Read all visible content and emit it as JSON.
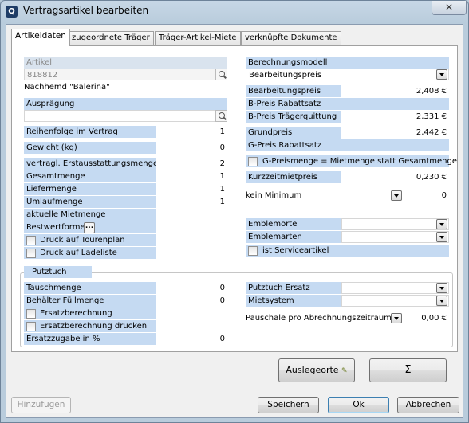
{
  "window": {
    "title": "Vertragsartikel bearbeiten",
    "app_icon_glyph": "Q",
    "close_glyph": "✕"
  },
  "tabs": [
    "Artikeldaten",
    "zugeordnete Träger",
    "Träger-Artikel-Miete",
    "verknüpfte Dokumente"
  ],
  "left": {
    "artikel_label": "Artikel",
    "artikel_value": "818812",
    "artikel_name": "Nachhemd \"Balerina\"",
    "auspraegung_label": "Ausprägung",
    "auspraegung_value": "",
    "reihenfolge_label": "Reihenfolge im Vertrag",
    "reihenfolge_value": "1",
    "gewicht_label": "Gewicht (kg)",
    "gewicht_value": "0",
    "erstausstattung_label": "vertragl. Erstausstattungsmenge",
    "erstausstattung_value": "2",
    "gesamtmenge_label": "Gesamtmenge",
    "gesamtmenge_value": "1",
    "liefermenge_label": "Liefermenge",
    "liefermenge_value": "1",
    "umlaufmenge_label": "Umlaufmenge",
    "umlaufmenge_value": "1",
    "mietmenge_label": "aktuelle Mietmenge",
    "restwertformel_label": "Restwertformel",
    "restwertformel_button": "...",
    "tourenplan_label": "Druck auf Tourenplan",
    "ladeliste_label": "Druck auf Ladeliste"
  },
  "right": {
    "berechnungsmodell_label": "Berechnungsmodell",
    "berechnungsmodell_value": "Bearbeitungspreis",
    "bearbeitungspreis_label": "Bearbeitungspreis",
    "bearbeitungspreis_value": "2,408 €",
    "bpreis_rabatt_label": "B-Preis Rabattsatz",
    "bpreis_rabatt_value": "",
    "bpreis_traeger_label": "B-Preis Trägerquittung",
    "bpreis_traeger_value": "2,331 €",
    "grundpreis_label": "Grundpreis",
    "grundpreis_value": "2,442 €",
    "gpreis_rabatt_label": "G-Preis Rabattsatz",
    "gpreis_rabatt_value": "",
    "gpreismenge_label": "G-Preismenge = Mietmenge statt Gesamtmenge",
    "kurzzeit_label": "Kurzzeitmietpreis",
    "kurzzeit_value": "0,230 €",
    "minimum_label": "kein Minimum",
    "minimum_value": "0",
    "emblemorte_label": "Emblemorte",
    "emblemarten_label": "Emblemarten",
    "serviceartikel_label": "ist Serviceartikel"
  },
  "putztuch": {
    "group_label": "Putztuch",
    "tauschmenge_label": "Tauschmenge",
    "tauschmenge_value": "0",
    "behaelter_label": "Behälter Füllmenge",
    "behaelter_value": "0",
    "ersatzberechnung_label": "Ersatzberechnung",
    "ersatzdruck_label": "Ersatzberechnung drucken",
    "ersatzzugabe_label": "Ersatzzugabe in %",
    "ersatzzugabe_value": "0",
    "putztuch_ersatz_label": "Putztuch Ersatz",
    "mietsystem_label": "Mietsystem",
    "pauschale_label": "Pauschale pro Abrechnungszeitraum",
    "pauschale_value": "0,00 €"
  },
  "buttons": {
    "auslegeorte": "Auslegeorte",
    "sigma": "Σ",
    "hinzufuegen": "Hinzufügen",
    "speichern": "Speichern",
    "ok": "Ok",
    "abbrechen": "Abbrechen"
  },
  "colors": {
    "label_bg": "#c5daf2",
    "titlebar": "#c7d7e6"
  }
}
